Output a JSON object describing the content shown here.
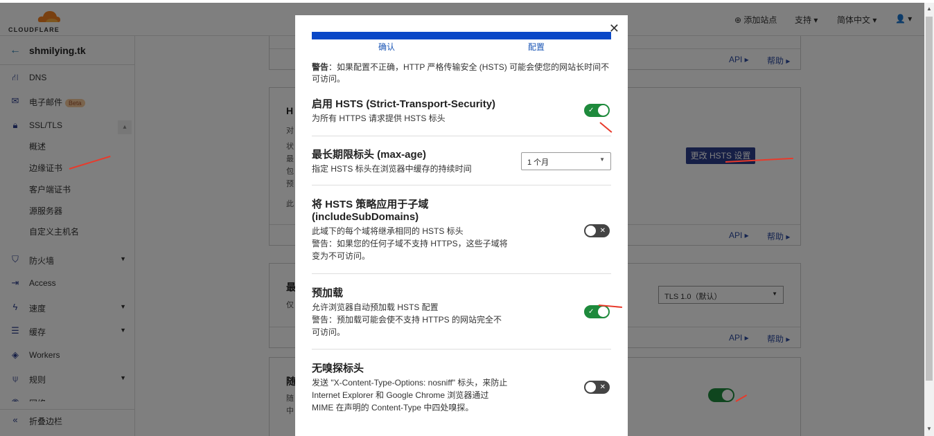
{
  "header": {
    "logo_text": "CLOUDFLARE",
    "add_site": "添加站点",
    "support": "支持",
    "language": "简体中文"
  },
  "sidebar": {
    "site_name": "shmilying.tk",
    "items": [
      {
        "label": "DNS",
        "icon": "dns-icon"
      },
      {
        "label": "电子邮件",
        "icon": "email-icon",
        "badge": "Beta"
      },
      {
        "label": "SSL/TLS",
        "icon": "lock-icon"
      },
      {
        "label": "防火墙",
        "icon": "shield-icon"
      },
      {
        "label": "Access",
        "icon": "access-icon"
      },
      {
        "label": "速度",
        "icon": "lightning-icon"
      },
      {
        "label": "缓存",
        "icon": "cache-icon"
      },
      {
        "label": "Workers",
        "icon": "workers-icon"
      },
      {
        "label": "规则",
        "icon": "rules-icon"
      },
      {
        "label": "网络",
        "icon": "network-icon"
      }
    ],
    "ssl_subitems": [
      "概述",
      "边缘证书",
      "客户端证书",
      "源服务器",
      "自定义主机名"
    ],
    "collapse_label": "折叠边栏"
  },
  "main": {
    "api_link": "API",
    "help_link": "帮助",
    "hsts_button": "更改 HSTS 设置",
    "tls_select": "TLS 1.0（默认）",
    "fragments": {
      "c2_title": "H",
      "c2_lines": [
        "对",
        "状",
        "最",
        "包",
        "预",
        "此"
      ],
      "c3_title": "最",
      "c3_line": "仅",
      "c4_title": "随",
      "c4_lines": [
        "随",
        "中"
      ]
    }
  },
  "modal": {
    "steps": [
      "确认",
      "配置"
    ],
    "progress_fraction": 1.0,
    "warning_label": "警告",
    "warning_text": "：如果配置不正确，HTTP 严格传输安全 (HSTS) 可能会使您的网站长时间不可访问。",
    "settings": {
      "enable": {
        "title": "启用 HSTS (Strict-Transport-Security)",
        "desc": "为所有 HTTPS 请求提供 HSTS 标头",
        "enabled": true
      },
      "max_age": {
        "title": "最长期限标头 (max-age)",
        "desc": "指定 HSTS 标头在浏览器中缓存的持续时间",
        "value": "1 个月"
      },
      "subdomains": {
        "title": "将 HSTS 策略应用于子域 (includeSubDomains)",
        "desc": "此域下的每个域将继承相同的 HSTS 标头",
        "warning": "警告：如果您的任何子域不支持 HTTPS，这些子域将变为不可访问。",
        "enabled": false
      },
      "preload": {
        "title": "预加载",
        "desc": "允许浏览器自动预加载 HSTS 配置",
        "warning": "警告：预加载可能会使不支持 HTTPS 的网站完全不可访问。",
        "enabled": true
      },
      "nosniff": {
        "title": "无嗅探标头",
        "desc": "发送 \"X-Content-Type-Options: nosniff\" 标头，来防止 Internet Explorer 和 Google Chrome 浏览器通过 MIME 在声明的 Content-Type 中四处嗅探。",
        "enabled": false
      }
    }
  },
  "colors": {
    "toggle_on": "#1e8a3c",
    "toggle_off": "#444444",
    "progress": "#0a48c7",
    "link": "#1a55b5",
    "annotation": "#e83a2b"
  }
}
